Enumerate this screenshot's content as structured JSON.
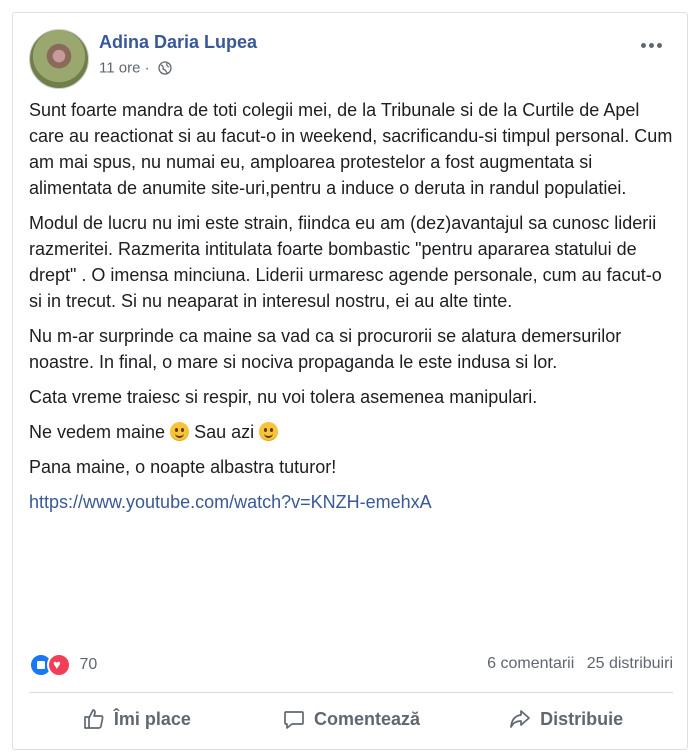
{
  "post": {
    "author": "Adina Daria Lupea",
    "time": "11 ore",
    "separator": "·",
    "paragraphs": [
      "Sunt foarte mandra de toti colegii mei, de la Tribunale si de la Curtile de Apel care au reactionat si au facut-o in weekend, sacrificandu-si timpul personal. Cum am mai spus, nu numai eu, amploarea protestelor a fost augmentata si alimentata de anumite site-uri,pentru a induce o deruta in randul populatiei.",
      "Modul de lucru nu imi este strain, fiindca eu am (dez)avantajul sa cunosc liderii razmeritei. Razmerita intitulata foarte bombastic \"pentru apararea statului de drept\" . O imensa minciuna. Liderii urmaresc agende personale, cum au facut-o si in trecut. Si nu neaparat in interesul nostru, ei au alte tinte.",
      "Nu m-ar surprinde ca maine sa vad ca si procurorii se alatura demersurilor noastre. In final, o mare si nociva propaganda le este indusa si lor.",
      "Cata vreme traiesc si respir, nu voi tolera asemenea manipulari."
    ],
    "emoji_line": {
      "part1": "Ne vedem maine",
      "part2": "Sau azi"
    },
    "closing": "Pana maine, o noapte albastra tuturor!",
    "link": "https://www.youtube.com/watch?v=KNZH-emehxA"
  },
  "stats": {
    "reaction_count": "70",
    "comments": "6 comentarii",
    "shares": "25 distribuiri"
  },
  "actions": {
    "like": "Îmi place",
    "comment": "Comentează",
    "share": "Distribuie"
  },
  "icons": [
    "globe-icon",
    "more-icon",
    "like-icon",
    "love-icon",
    "thumbs-up-icon",
    "comment-icon",
    "share-icon",
    "smile-emoji-icon"
  ],
  "colors": {
    "link": "#385898",
    "like": "#1877f2",
    "love": "#f33e58",
    "muted": "#606770"
  }
}
